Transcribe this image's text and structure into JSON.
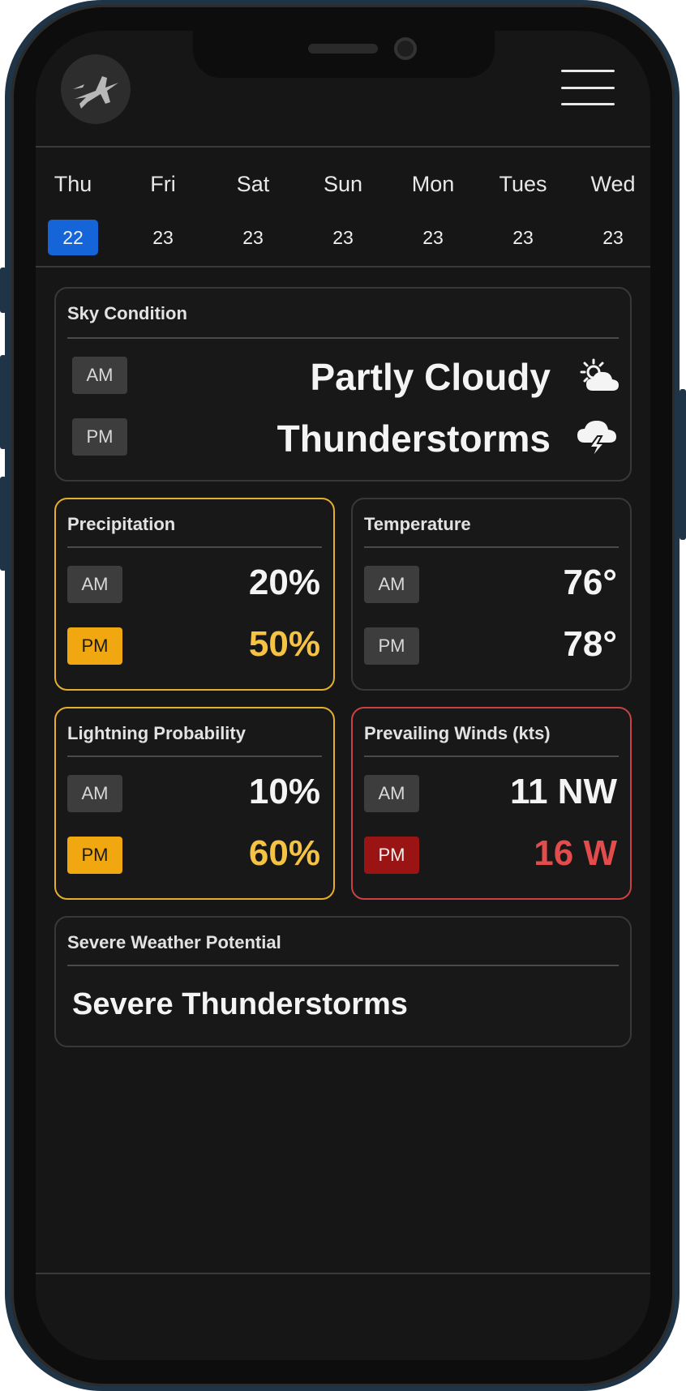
{
  "days": [
    {
      "name": "Thu",
      "date": "22",
      "selected": true
    },
    {
      "name": "Fri",
      "date": "23",
      "selected": false
    },
    {
      "name": "Sat",
      "date": "23",
      "selected": false
    },
    {
      "name": "Sun",
      "date": "23",
      "selected": false
    },
    {
      "name": "Mon",
      "date": "23",
      "selected": false
    },
    {
      "name": "Tues",
      "date": "23",
      "selected": false
    },
    {
      "name": "Wed",
      "date": "23",
      "selected": false
    }
  ],
  "sky": {
    "title": "Sky Condition",
    "am_label": "AM",
    "am_value": "Partly Cloudy",
    "am_icon": "partly-cloudy-icon",
    "pm_label": "PM",
    "pm_value": "Thunderstorms",
    "pm_icon": "thunderstorm-icon"
  },
  "precipitation": {
    "title": "Precipitation",
    "am_label": "AM",
    "am_value": "20%",
    "pm_label": "PM",
    "pm_value": "50%"
  },
  "temperature": {
    "title": "Temperature",
    "am_label": "AM",
    "am_value": "76°",
    "pm_label": "PM",
    "pm_value": "78°"
  },
  "lightning": {
    "title": "Lightning Probability",
    "am_label": "AM",
    "am_value": "10%",
    "pm_label": "PM",
    "pm_value": "60%"
  },
  "winds": {
    "title": "Prevailing Winds (kts)",
    "am_label": "AM",
    "am_value": "11 NW",
    "pm_label": "PM",
    "pm_value": "16 W"
  },
  "severe": {
    "title": "Severe Weather Potential",
    "value": "Severe Thunderstorms"
  },
  "colors": {
    "accent_blue": "#1565d8",
    "warning_yellow": "#f0a710",
    "danger_red": "#c84242",
    "background": "#161616"
  }
}
